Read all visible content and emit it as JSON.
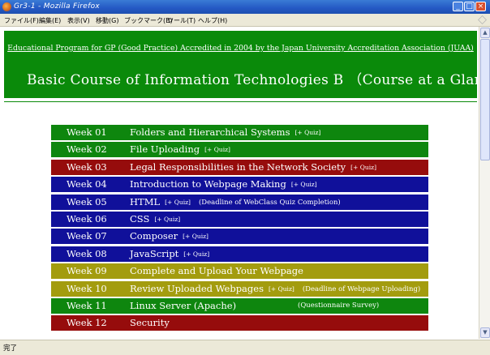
{
  "window": {
    "title": "Gr3-1 - Mozilla Firefox",
    "min": "_",
    "max": "□",
    "close": "×"
  },
  "menu": [
    "ファイル(F)",
    "編集(E)",
    "表示(V)",
    "移動(G)",
    "ブックマーク(B)",
    "ツール(T)",
    "ヘルプ(H)"
  ],
  "header": {
    "link": "Educational Program for GP (Good Practice) Accredited in 2004 by the Japan University Accreditation Association (JUAA)",
    "title": "Basic Course of Information Technologies B （Course at a Glance）",
    "color": "#0a8a0a"
  },
  "colors": {
    "green": "#0e860e",
    "red": "#960c0c",
    "blue": "#10109a",
    "olive": "#a39c0e"
  },
  "weeks": [
    {
      "week": "Week 01",
      "topic": "Folders and Hierarchical Systems",
      "quiz": "[+ Quiz]",
      "note": "",
      "color": "green"
    },
    {
      "week": "Week 02",
      "topic": "File Uploading",
      "quiz": "[+ Quiz]",
      "note": "",
      "color": "green"
    },
    {
      "week": "Week 03",
      "topic": "Legal Responsibilities in the Network Society",
      "quiz": "[+ Quiz]",
      "note": "",
      "color": "red"
    },
    {
      "week": "Week 04",
      "topic": "Introduction to Webpage Making",
      "quiz": "[+ Quiz]",
      "note": "",
      "color": "blue"
    },
    {
      "week": "Week 05",
      "topic": "HTML",
      "quiz": "[+ Quiz]",
      "note": "(Deadline of WebClass Quiz Completion)",
      "color": "blue"
    },
    {
      "week": "Week 06",
      "topic": "CSS",
      "quiz": "[+ Quiz]",
      "note": "",
      "color": "blue"
    },
    {
      "week": "Week 07",
      "topic": "Composer",
      "quiz": "[+ Quiz]",
      "note": "",
      "color": "blue"
    },
    {
      "week": "Week 08",
      "topic": "JavaScript",
      "quiz": "[+ Quiz]",
      "note": "",
      "color": "blue"
    },
    {
      "week": "Week 09",
      "topic": "Complete and Upload Your Webpage",
      "quiz": "",
      "note": "",
      "color": "olive"
    },
    {
      "week": "Week 10",
      "topic": "Review Uploaded Webpages",
      "quiz": "[+ Quiz]",
      "note": "(Deadline of Webpage Uploading)",
      "color": "olive"
    },
    {
      "week": "Week 11",
      "topic": "Linux Server (Apache)",
      "quiz": "",
      "note": "(Questionnaire Survey)",
      "color": "green"
    },
    {
      "week": "Week 12",
      "topic": "Security",
      "quiz": "",
      "note": "",
      "color": "red"
    }
  ],
  "status": "完了"
}
